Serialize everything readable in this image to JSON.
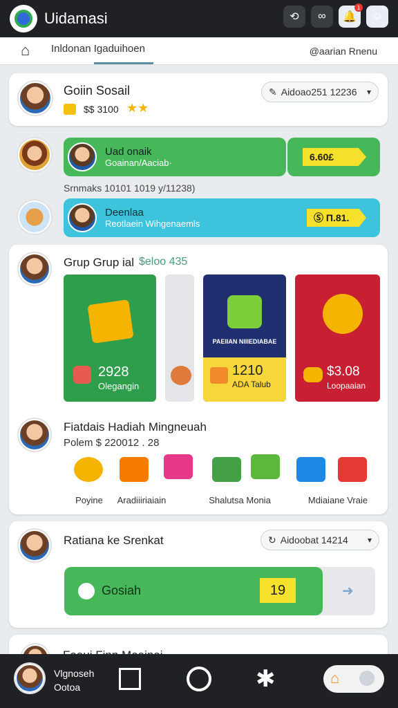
{
  "app": {
    "title": "Uidamasi"
  },
  "top_icons": [
    "link-icon",
    "infinity-icon",
    "notification-icon",
    "profile-icon"
  ],
  "top_badge": "1",
  "subnav": {
    "breadcrumb": "Inldonan Igaduihoen",
    "right_label": "@aarian Rnenu"
  },
  "profile": {
    "name": "Goiin Sosail",
    "coins": "$$ 3100",
    "selector": "Aidoao251 12236"
  },
  "rows": [
    {
      "title": "Uad onaik",
      "subtitle": "Goainan/Aaciab·",
      "reward": "6.60£",
      "color": "#47b85a"
    },
    {
      "title": "Deenlaa",
      "subtitle": "Reotlaein Wihgenaemls",
      "reward": "Ⓢ Π.81.",
      "color": "#3ec3dd"
    }
  ],
  "rows_caption": "Srnmaks 10101 1019 y/11238)",
  "group": {
    "title": "Grup Grup ial",
    "amount": "$eloo 435",
    "tiles": [
      {
        "value": "2928",
        "caption": "Olegangin",
        "color": "#2f9e4c"
      },
      {
        "banner": "PAEIIAN NIIIEDIABAE",
        "value": "1210",
        "caption": "ADA Talub",
        "color": "#f6d63a"
      },
      {
        "value": "$3.08",
        "caption": "Loopaaian",
        "color": "#c81f32"
      }
    ]
  },
  "prizes": {
    "title": "Fiatdais Hadiah Mingneuah",
    "subtitle": "Polem $ 220012 . 28",
    "items": [
      {
        "label": "Poyine",
        "color": "#f4b400"
      },
      {
        "label": "Aradiiiriaiain",
        "color": "#f57c00"
      },
      {
        "label": "Shalutsa Monia",
        "color": "#43a047"
      },
      {
        "label": "Mdiaiane Vraie",
        "color": "#1e88e5"
      }
    ]
  },
  "reward_card": {
    "title": "Ratiana ke Srenkat",
    "selector": "Aidoobat 14214",
    "button": "Gosiah",
    "badge": "19"
  },
  "peek": {
    "title": "Foaui Finn Moainai"
  },
  "bottom": {
    "user_line1": "Vlgnoseh",
    "user_line2": "Ootoa"
  },
  "colors": {
    "accent_green": "#47b85a",
    "accent_cyan": "#3ec3dd",
    "accent_red": "#c81f32",
    "accent_yellow": "#f5e12b",
    "dark_bar": "#1f2124"
  }
}
